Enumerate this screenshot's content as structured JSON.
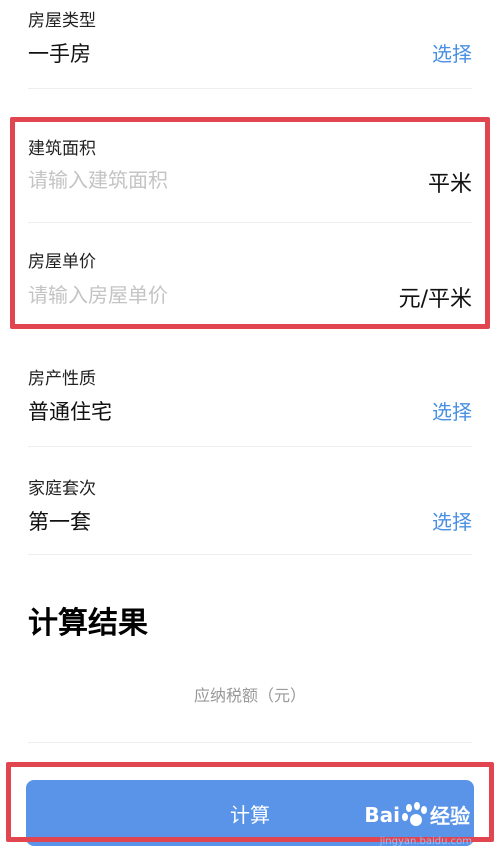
{
  "house_type": {
    "label": "房屋类型",
    "value": "一手房",
    "action": "选择"
  },
  "building_area": {
    "label": "建筑面积",
    "placeholder": "请输入建筑面积",
    "unit": "平米"
  },
  "unit_price": {
    "label": "房屋单价",
    "placeholder": "请输入房屋单价",
    "unit": "元/平米"
  },
  "property_nature": {
    "label": "房产性质",
    "value": "普通住宅",
    "action": "选择"
  },
  "family_set": {
    "label": "家庭套次",
    "value": "第一套",
    "action": "选择"
  },
  "result": {
    "title": "计算结果",
    "tax_label": "应纳税额（元）"
  },
  "calculate_button": {
    "label": "计算"
  },
  "watermark": {
    "brand_a": "Bai",
    "brand_b": "经验",
    "url": "jingyan.baidu.com"
  },
  "colors": {
    "accent": "#4a90e2",
    "button": "#5a94e8",
    "highlight": "#e04550"
  }
}
